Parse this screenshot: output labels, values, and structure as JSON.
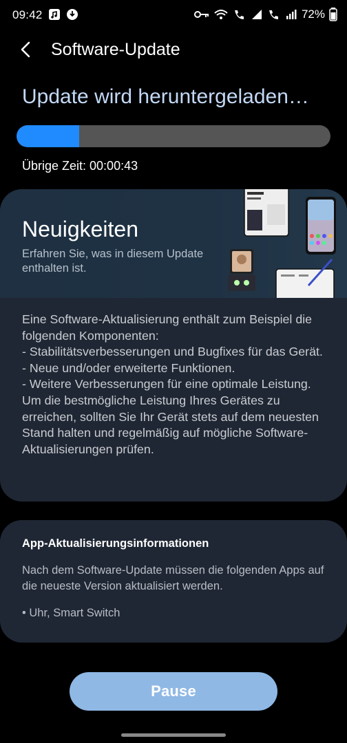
{
  "status_bar": {
    "time": "09:42",
    "battery": "72%"
  },
  "header": {
    "title": "Software-Update"
  },
  "download": {
    "title": "Update wird heruntergeladen…",
    "progress_fraction": 0.2,
    "remaining": "Übrige Zeit: 00:00:43"
  },
  "news": {
    "title": "Neuigkeiten",
    "subtitle": "Erfahren Sie, was in diesem Update enthalten ist.",
    "body": "Eine Software-Aktualisierung enthält zum Beispiel die folgenden Komponenten:\n - Stabilitätsverbesserungen und Bugfixes für das Gerät.\n - Neue und/oder erweiterte Funktionen.\n - Weitere Verbesserungen für eine optimale Leistung.\nUm die bestmögliche Leistung Ihres Gerätes zu erreichen, sollten Sie Ihr Gerät stets auf dem neuesten Stand halten und regelmäßig auf mögliche Software-Aktualisierungen prüfen."
  },
  "app_info": {
    "title": "App-Aktualisierungsinformationen",
    "text": "Nach dem Software-Update müssen die folgenden Apps auf die neueste Version aktualisiert werden.",
    "apps": "• Uhr, Smart Switch"
  },
  "actions": {
    "pause_label": "Pause"
  },
  "colors": {
    "accent": "#1f8bff",
    "button": "#8fb8e5",
    "card": "#202734"
  }
}
